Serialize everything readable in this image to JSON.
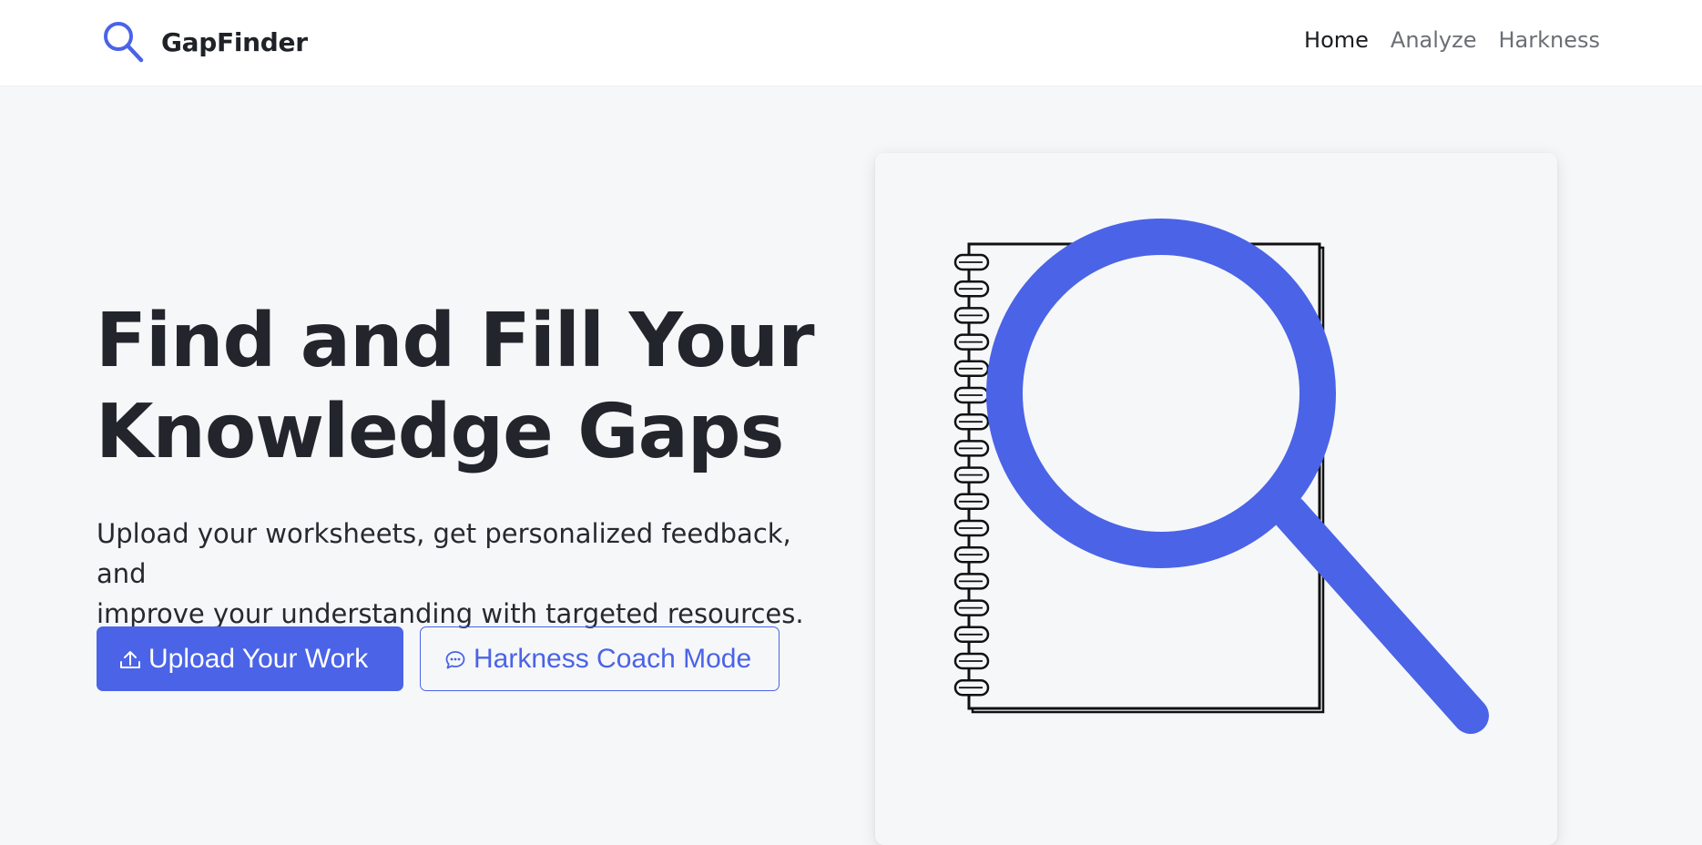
{
  "brand": {
    "name": "GapFinder",
    "icon": "magnifier-icon",
    "accent_color": "#4a63e7"
  },
  "nav": {
    "items": [
      {
        "label": "Home",
        "active": true
      },
      {
        "label": "Analyze",
        "active": false
      },
      {
        "label": "Harkness",
        "active": false
      }
    ]
  },
  "hero": {
    "title_line1": "Find and Fill Your",
    "title_line2": "Knowledge Gaps",
    "subtitle_line1": "Upload your worksheets, get personalized feedback, and",
    "subtitle_line2": "improve your understanding with targeted resources.",
    "primary_button": {
      "label": "Upload Your Work",
      "icon": "upload-icon"
    },
    "secondary_button": {
      "label": "Harkness Coach Mode",
      "icon": "chat-bubble-icon"
    }
  },
  "illustration": {
    "icon": "notebook-magnifier-illustration"
  }
}
